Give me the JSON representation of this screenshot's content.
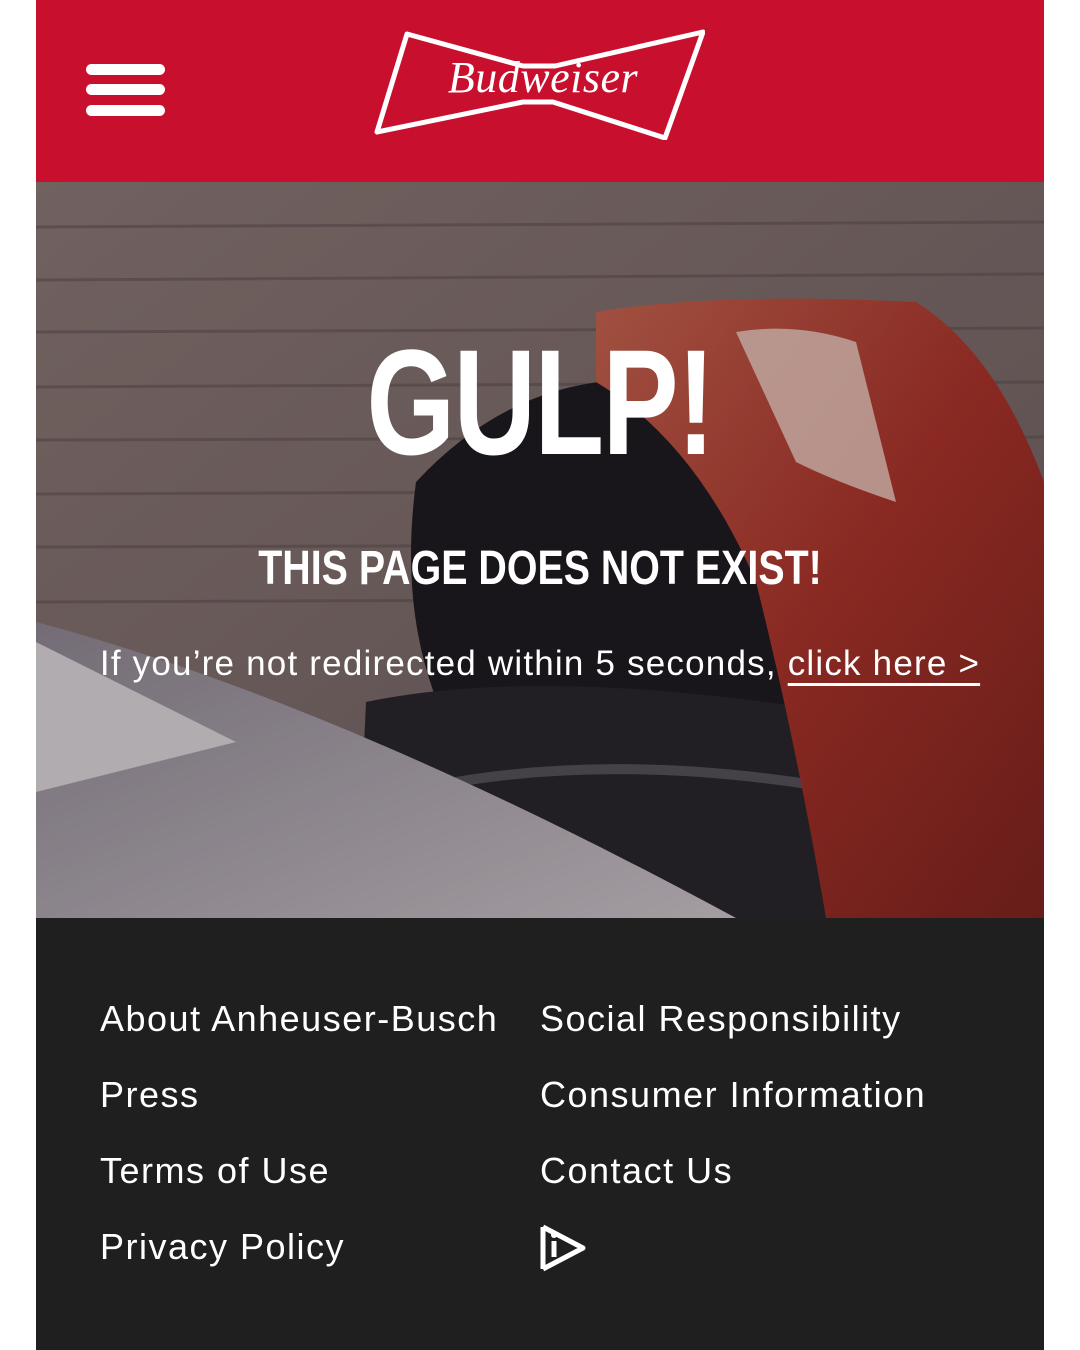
{
  "header": {
    "brand": "Budweiser",
    "background_color": "#c8102e",
    "menu_icon": "hamburger-menu-icon"
  },
  "hero": {
    "headline": "GULP!",
    "subheadline": "THIS PAGE DOES NOT EXIST!",
    "redirect_text": "If you’re not redirected within 5 seconds, ",
    "redirect_link": "click here >"
  },
  "footer": {
    "background_color": "#1f1f1f",
    "links_left": [
      "About Anheuser-Busch",
      "Press",
      "Terms of Use",
      "Privacy Policy"
    ],
    "links_right": [
      "Social Responsibility",
      "Consumer Information",
      "Contact Us"
    ],
    "ab_icon": "anheuser-busch-play-icon"
  }
}
